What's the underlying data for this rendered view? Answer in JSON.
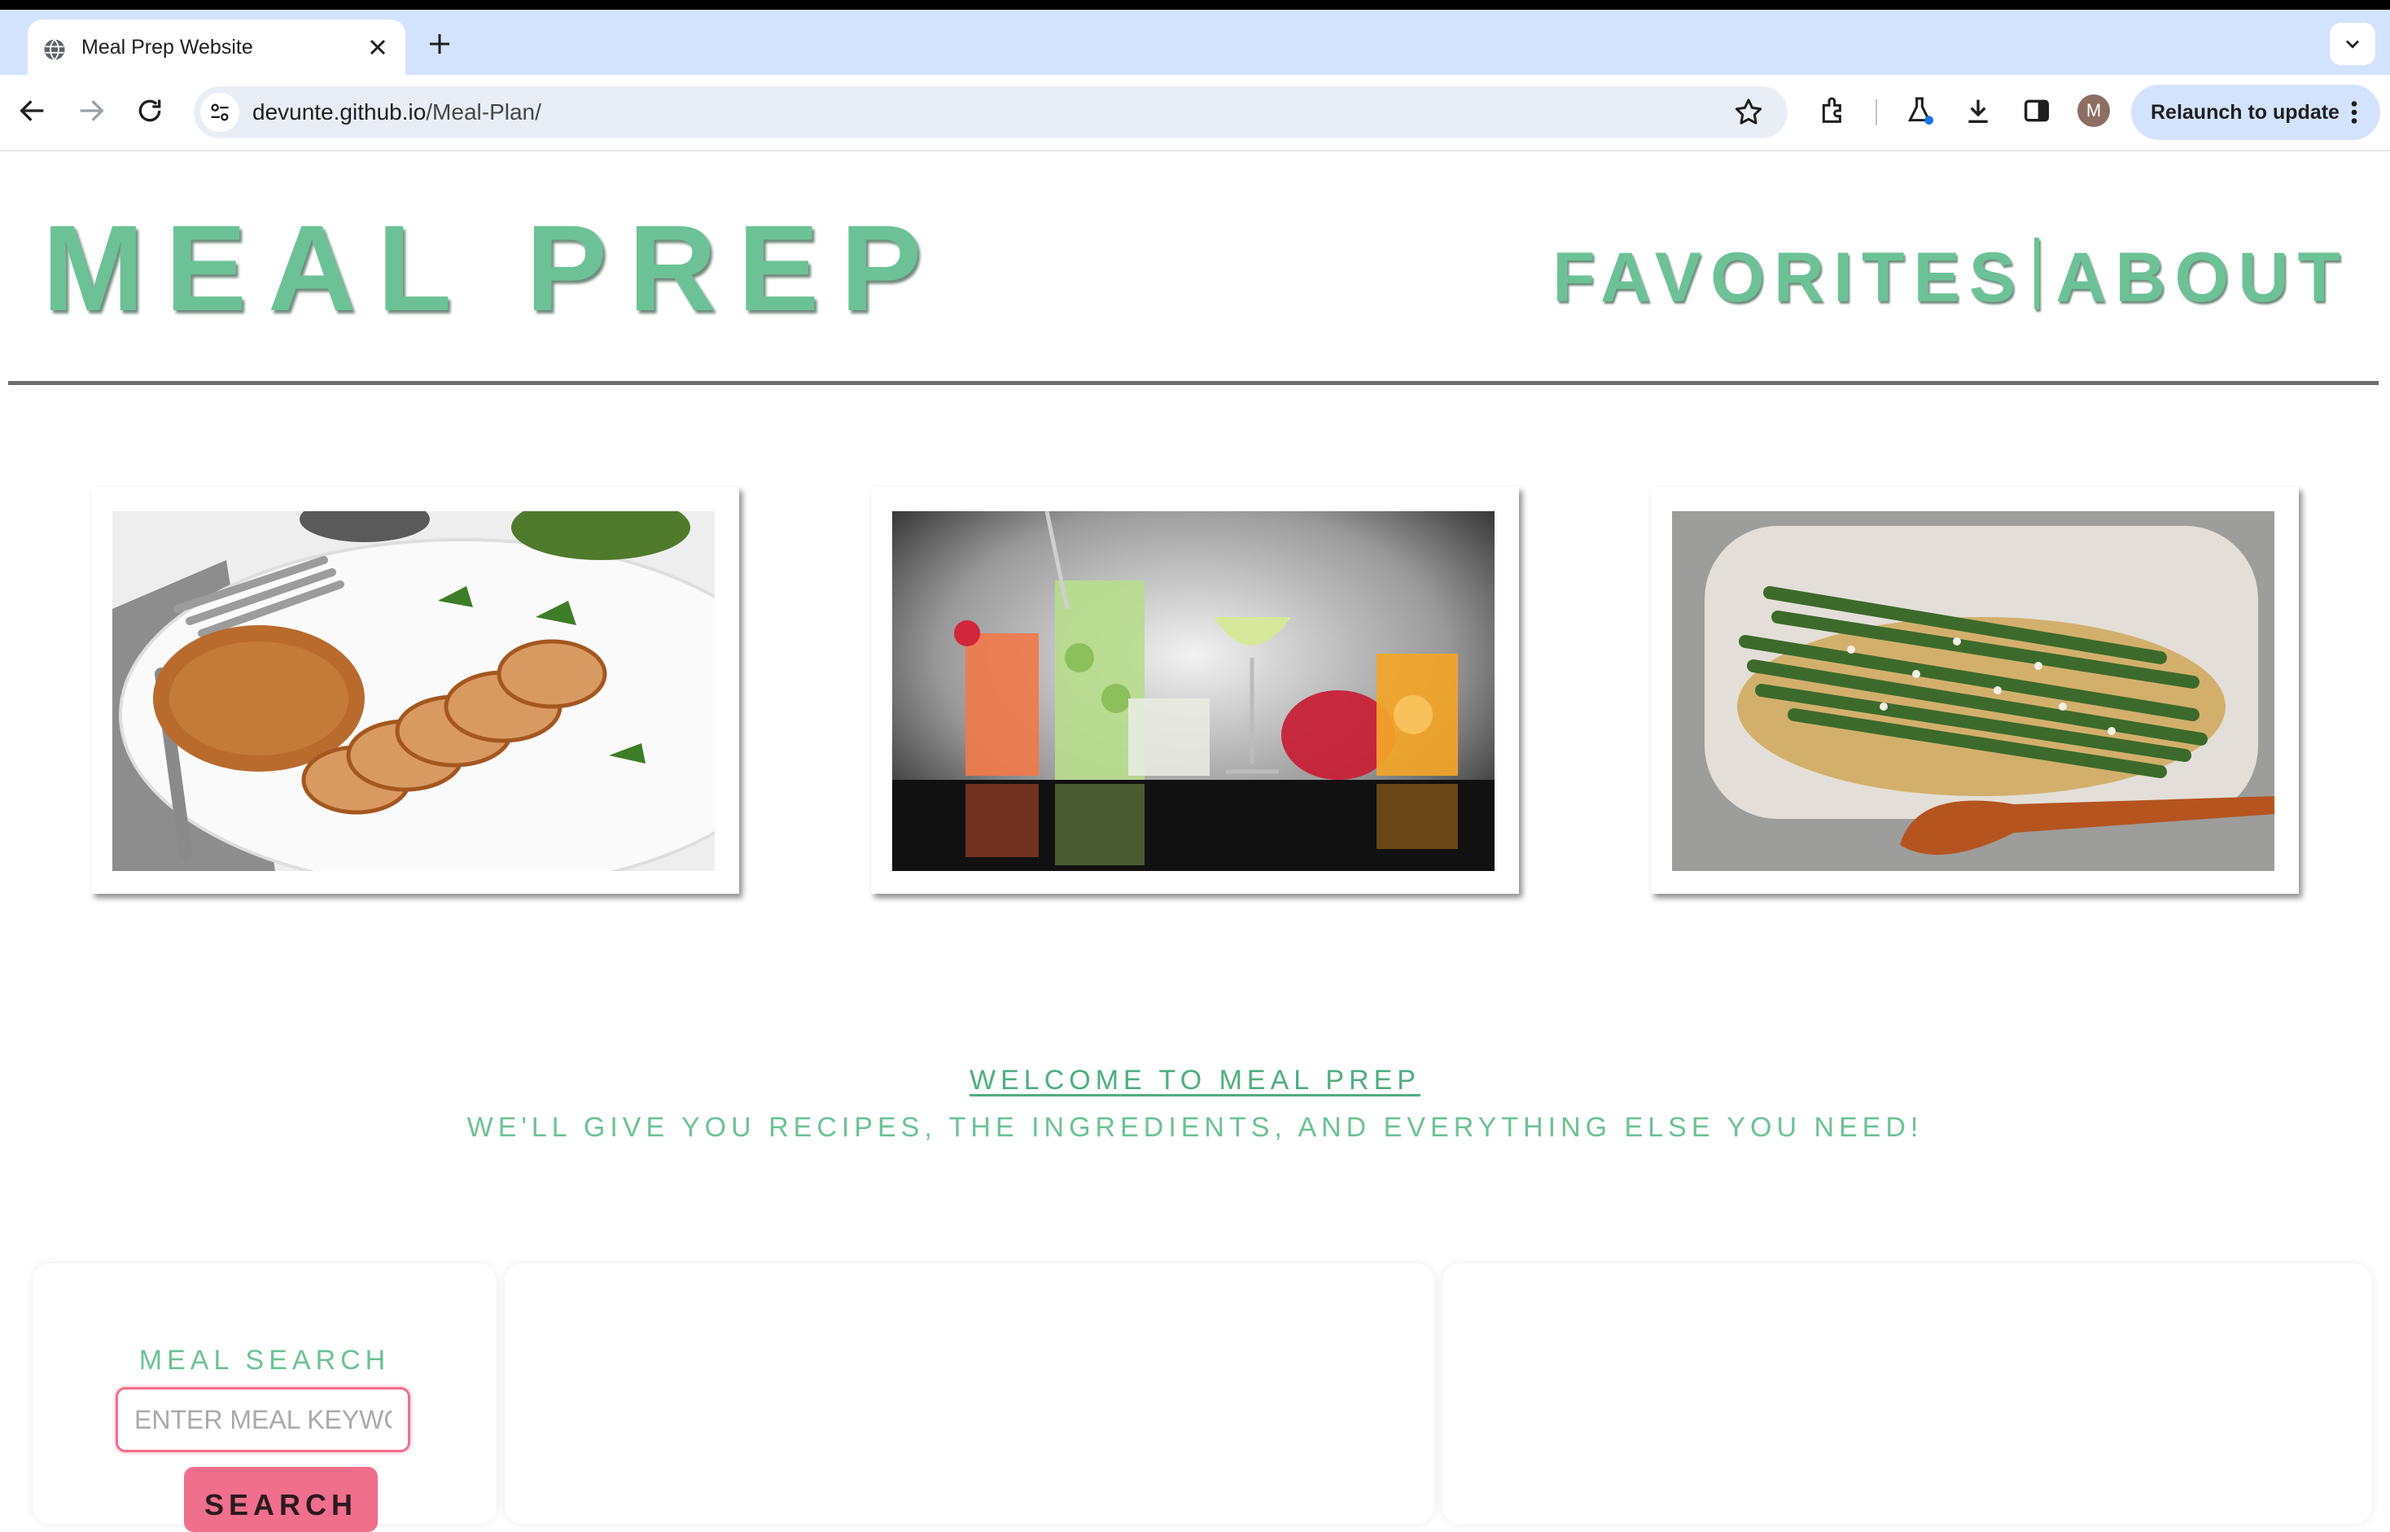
{
  "browser": {
    "tab_title": "Meal Prep Website",
    "url_host": "devunte.github.io",
    "url_path": "/Meal-Plan/",
    "relaunch_label": "Relaunch to update",
    "avatar_initial": "M"
  },
  "header": {
    "brand": "MEAL PREP",
    "nav_favorites": "FAVORITES",
    "nav_about": "ABOUT"
  },
  "gallery": [
    {
      "icon": "grilled-chicken-image"
    },
    {
      "icon": "drinks-image"
    },
    {
      "icon": "asparagus-image"
    }
  ],
  "welcome": {
    "title": "WELCOME TO MEAL PREP",
    "subtitle": "WE'LL GIVE YOU RECIPES, THE INGREDIENTS, AND EVERYTHING ELSE YOU NEED!"
  },
  "search": {
    "title": "MEAL SEARCH",
    "placeholder": "ENTER MEAL KEYWORD",
    "value": "",
    "button_label": "SEARCH"
  },
  "colors": {
    "brand_green": "#6cc296",
    "accent_pink": "#f06f8c",
    "tab_bar": "#d3e3fd"
  }
}
